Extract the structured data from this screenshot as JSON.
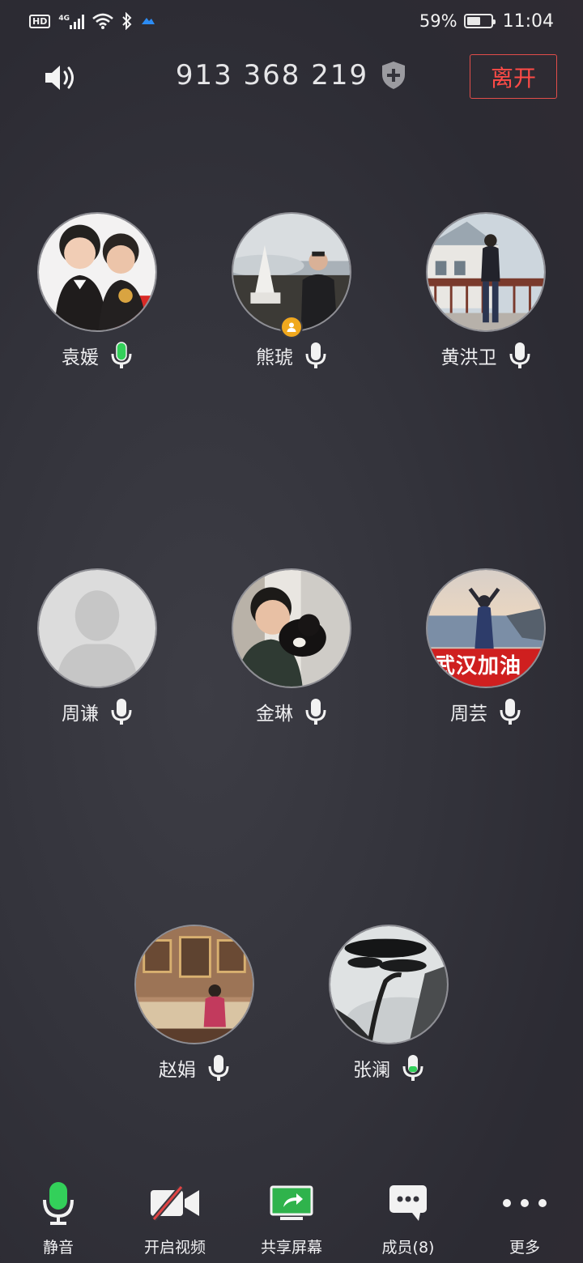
{
  "status_bar": {
    "hd_label": "HD",
    "network": "4G",
    "battery_percent": "59%",
    "battery_level": 0.59,
    "time": "11:04"
  },
  "header": {
    "speaker_icon": "speaker-icon",
    "meeting_id": "913 368 219",
    "shield_icon": "shield-plus-icon",
    "leave_label": "离开"
  },
  "participants": [
    {
      "name": "袁媛",
      "mic": "active",
      "host": false
    },
    {
      "name": "熊琥",
      "mic": "idle",
      "host": true
    },
    {
      "name": "黄洪卫",
      "mic": "idle",
      "host": false
    },
    {
      "name": "周谦",
      "mic": "idle",
      "host": false
    },
    {
      "name": "金琳",
      "mic": "idle",
      "host": false
    },
    {
      "name": "周芸",
      "mic": "idle",
      "host": false
    },
    {
      "name": "赵娟",
      "mic": "idle",
      "host": false
    },
    {
      "name": "张澜",
      "mic": "low",
      "host": false
    }
  ],
  "avatar_overlays": {
    "zhouyun_banner_text": "武汉加油"
  },
  "toolbar": {
    "mute_label": "静音",
    "video_label": "开启视频",
    "share_label": "共享屏幕",
    "members_label": "成员(8)",
    "more_label": "更多"
  },
  "colors": {
    "accent_green": "#33d05a",
    "leave_red": "#ff4b47",
    "host_badge": "#f0a81e",
    "video_off_red": "#e04444"
  }
}
